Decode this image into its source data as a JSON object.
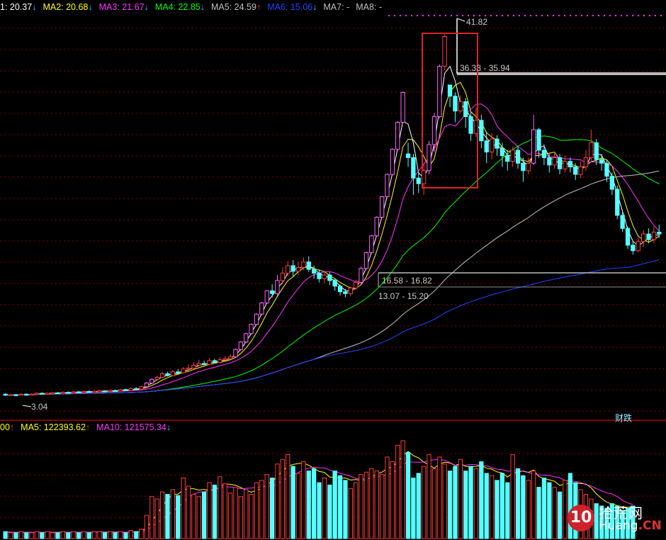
{
  "legend": {
    "items": [
      {
        "label": "1: 20.37",
        "arrow": "↓",
        "color": "#ffffff",
        "arrow_color": "#33ccff"
      },
      {
        "label": "MA2: 20.68",
        "arrow": "↓",
        "color": "#ffff00",
        "arrow_color": "#33ccff"
      },
      {
        "label": "MA3: 21.67",
        "arrow": "↓",
        "color": "#ff33ff",
        "arrow_color": "#33ccff"
      },
      {
        "label": "MA4: 22.85",
        "arrow": "↓",
        "color": "#00ff00",
        "arrow_color": "#33ccff"
      },
      {
        "label": "MA5: 24.59",
        "arrow": "↑",
        "color": "#c0c0c0",
        "arrow_color": "#ff3030"
      },
      {
        "label": "MA6: 15.06",
        "arrow": "↓",
        "color": "#2244ff",
        "arrow_color": "#33ccff"
      },
      {
        "label": "MA7: -",
        "arrow": "",
        "color": "#c0c0c0",
        "arrow_color": "#33ccff"
      },
      {
        "label": "MA8: -",
        "arrow": "",
        "color": "#c0c0c0",
        "arrow_color": "#33ccff"
      }
    ]
  },
  "volume_legend": {
    "items": [
      {
        "label": "00",
        "arrow": "↑",
        "color": "#ffff00",
        "arrow_color": "#ff3030"
      },
      {
        "label": "MA5: 122393.62",
        "arrow": "↑",
        "color": "#ffff00",
        "arrow_color": "#ff3030"
      },
      {
        "label": "MA10: 121575.34",
        "arrow": "↓",
        "color": "#ff33ff",
        "arrow_color": "#33ccff"
      }
    ]
  },
  "annotations": {
    "high": "41.82",
    "low": "3.04",
    "range1": "36.33 - 35.94",
    "range2": "16.58 - 16.82",
    "range3": "13.07 - 15.20",
    "tag": "财",
    "tag2": "跌"
  },
  "logo": {
    "digit": "10",
    "cn": "拾荒网",
    "en_prefix": "Huang",
    "en_suffix": ".CN"
  },
  "colors": {
    "up": "#ff3b3b",
    "down": "#54ffff",
    "limit_up": "#ff66ff",
    "grid": "#8b0000",
    "ma_short": "#ffffff",
    "ma2": "#ffff00",
    "ma3": "#ff33ff",
    "ma4": "#00ff00",
    "ma5": "#c0c0c0",
    "ma6": "#2244ff"
  },
  "chart_data": {
    "type": "candlestick",
    "price_range": [
      2.0,
      44.0
    ],
    "candles": [
      [
        3.2,
        3.1,
        3.3,
        3.0
      ],
      [
        3.1,
        3.15,
        3.25,
        3.05
      ],
      [
        3.15,
        3.1,
        3.2,
        3.04
      ],
      [
        3.1,
        3.2,
        3.3,
        3.05
      ],
      [
        3.2,
        3.15,
        3.3,
        3.1
      ],
      [
        3.15,
        3.2,
        3.3,
        3.1
      ],
      [
        3.2,
        3.3,
        3.4,
        3.15
      ],
      [
        3.3,
        3.25,
        3.4,
        3.2
      ],
      [
        3.25,
        3.3,
        3.4,
        3.2
      ],
      [
        3.3,
        3.35,
        3.45,
        3.25
      ],
      [
        3.35,
        3.3,
        3.45,
        3.25
      ],
      [
        3.3,
        3.4,
        3.5,
        3.25
      ],
      [
        3.4,
        3.35,
        3.5,
        3.3
      ],
      [
        3.35,
        3.45,
        3.55,
        3.3
      ],
      [
        3.45,
        3.4,
        3.55,
        3.35
      ],
      [
        3.4,
        3.5,
        3.6,
        3.35
      ],
      [
        3.5,
        3.45,
        3.6,
        3.4
      ],
      [
        3.45,
        3.5,
        3.6,
        3.4
      ],
      [
        3.5,
        3.55,
        3.65,
        3.45
      ],
      [
        3.55,
        3.5,
        3.65,
        3.45
      ],
      [
        3.5,
        3.6,
        3.7,
        3.45
      ],
      [
        3.6,
        3.55,
        3.7,
        3.5
      ],
      [
        3.55,
        3.7,
        3.8,
        3.5
      ],
      [
        3.7,
        3.6,
        3.8,
        3.55
      ],
      [
        3.6,
        3.8,
        3.9,
        3.55
      ],
      [
        3.8,
        3.75,
        3.95,
        3.7
      ],
      [
        3.75,
        4.0,
        4.1,
        3.7
      ],
      [
        4.0,
        4.4,
        4.5,
        3.95
      ],
      [
        4.4,
        4.8,
        4.9,
        4.3
      ],
      [
        4.8,
        5.0,
        5.2,
        4.7
      ],
      [
        5.0,
        5.4,
        5.6,
        4.9
      ],
      [
        5.4,
        5.2,
        5.6,
        5.1
      ],
      [
        5.2,
        5.6,
        5.8,
        5.1
      ],
      [
        5.6,
        5.5,
        5.9,
        5.4
      ],
      [
        5.5,
        5.9,
        6.1,
        5.4
      ],
      [
        5.9,
        6.0,
        6.4,
        5.8
      ],
      [
        6.0,
        6.3,
        6.6,
        5.9
      ],
      [
        6.3,
        6.5,
        6.9,
        6.2
      ],
      [
        6.5,
        6.4,
        6.8,
        6.3
      ],
      [
        6.4,
        6.8,
        7.1,
        6.3
      ],
      [
        6.8,
        6.6,
        7.0,
        6.5
      ],
      [
        6.6,
        6.9,
        7.2,
        6.5
      ],
      [
        6.9,
        7.0,
        7.3,
        6.8
      ],
      [
        7.0,
        7.2,
        7.5,
        6.9
      ],
      [
        7.2,
        8.0,
        8.1,
        7.1
      ],
      [
        8.0,
        8.8,
        8.9,
        7.9
      ],
      [
        8.8,
        9.7,
        9.8,
        8.7
      ],
      [
        9.7,
        10.7,
        10.8,
        9.6
      ],
      [
        10.7,
        11.8,
        11.9,
        10.6
      ],
      [
        11.8,
        13.0,
        13.1,
        11.7
      ],
      [
        13.0,
        14.3,
        14.4,
        12.9
      ],
      [
        14.3,
        14.0,
        15.0,
        13.6
      ],
      [
        14.0,
        15.4,
        16.0,
        13.8
      ],
      [
        15.4,
        16.2,
        16.8,
        15.0
      ],
      [
        16.2,
        17.0,
        17.5,
        15.9
      ],
      [
        17.0,
        16.4,
        17.6,
        15.8
      ],
      [
        16.4,
        16.8,
        17.4,
        16.0
      ],
      [
        16.8,
        17.4,
        17.9,
        16.5
      ],
      [
        17.4,
        16.6,
        18.0,
        16.3
      ],
      [
        16.6,
        16.2,
        17.0,
        15.6
      ],
      [
        16.2,
        15.6,
        16.6,
        15.2
      ],
      [
        15.6,
        16.0,
        16.4,
        15.1
      ],
      [
        16.0,
        15.4,
        16.3,
        14.9
      ],
      [
        15.4,
        14.8,
        15.6,
        14.3
      ],
      [
        14.8,
        14.2,
        15.0,
        13.8
      ],
      [
        14.2,
        14.0,
        14.5,
        13.6
      ],
      [
        14.0,
        14.6,
        14.8,
        13.7
      ],
      [
        14.6,
        15.2,
        15.5,
        14.4
      ],
      [
        15.2,
        16.7,
        16.9,
        15.0
      ],
      [
        16.7,
        18.4,
        18.5,
        16.6
      ],
      [
        18.4,
        20.2,
        20.3,
        18.3
      ],
      [
        20.2,
        22.2,
        22.3,
        20.1
      ],
      [
        22.2,
        24.4,
        24.5,
        22.1
      ],
      [
        24.4,
        26.8,
        26.9,
        24.3
      ],
      [
        26.8,
        29.5,
        29.6,
        26.7
      ],
      [
        29.5,
        32.4,
        32.5,
        29.4
      ],
      [
        32.4,
        35.6,
        35.7,
        32.3
      ],
      [
        29.0,
        28.6,
        30.2,
        27.6
      ],
      [
        28.6,
        26.4,
        29.0,
        24.6
      ],
      [
        26.4,
        25.8,
        27.0,
        24.8
      ],
      [
        25.8,
        27.2,
        28.0,
        24.6
      ],
      [
        27.2,
        30.0,
        30.4,
        26.8
      ],
      [
        30.0,
        33.0,
        33.4,
        29.2
      ],
      [
        33.0,
        38.4,
        38.6,
        32.8
      ],
      [
        38.4,
        41.6,
        41.82,
        38.0
      ],
      [
        36.4,
        35.2,
        36.33,
        34.0
      ],
      [
        35.2,
        33.6,
        35.6,
        32.4
      ],
      [
        33.6,
        34.6,
        35.3,
        33.4
      ],
      [
        34.6,
        33.0,
        35.0,
        31.8
      ],
      [
        33.0,
        31.2,
        33.6,
        30.4
      ],
      [
        31.2,
        32.6,
        34.0,
        30.8
      ],
      [
        32.6,
        30.4,
        33.2,
        29.6
      ],
      [
        30.4,
        29.2,
        31.4,
        28.0
      ],
      [
        29.2,
        30.6,
        31.2,
        28.4
      ],
      [
        30.6,
        29.6,
        31.0,
        28.8
      ],
      [
        29.6,
        28.8,
        30.2,
        27.6
      ],
      [
        28.8,
        28.2,
        29.4,
        27.2
      ],
      [
        28.2,
        29.4,
        29.8,
        27.6
      ],
      [
        29.4,
        28.0,
        29.8,
        27.4
      ],
      [
        28.0,
        27.2,
        28.6,
        26.0
      ],
      [
        27.2,
        28.0,
        28.6,
        26.8
      ],
      [
        28.0,
        31.6,
        33.2,
        27.8
      ],
      [
        31.6,
        29.4,
        31.8,
        28.6
      ],
      [
        29.4,
        28.6,
        30.0,
        27.8
      ],
      [
        28.6,
        27.8,
        29.0,
        27.0
      ],
      [
        27.8,
        28.6,
        29.2,
        27.4
      ],
      [
        28.6,
        27.4,
        29.0,
        26.8
      ],
      [
        27.4,
        28.2,
        28.8,
        27.0
      ],
      [
        28.2,
        27.6,
        28.6,
        27.0
      ],
      [
        27.6,
        26.8,
        28.0,
        26.2
      ],
      [
        26.8,
        27.6,
        28.2,
        26.4
      ],
      [
        27.6,
        28.6,
        29.4,
        27.2
      ],
      [
        28.6,
        30.2,
        31.6,
        28.2
      ],
      [
        30.2,
        28.4,
        30.6,
        27.8
      ],
      [
        28.4,
        28.0,
        29.0,
        27.2
      ],
      [
        28.0,
        26.6,
        28.4,
        26.0
      ],
      [
        26.6,
        25.2,
        27.0,
        24.6
      ],
      [
        25.2,
        22.4,
        25.6,
        22.0
      ],
      [
        22.4,
        21.0,
        22.8,
        20.6
      ],
      [
        21.0,
        19.2,
        21.2,
        18.8
      ],
      [
        19.2,
        18.6,
        19.6,
        18.2
      ],
      [
        18.6,
        19.6,
        20.0,
        18.4
      ],
      [
        19.6,
        20.4,
        20.8,
        19.0
      ],
      [
        20.4,
        19.8,
        21.0,
        19.4
      ],
      [
        19.8,
        20.6,
        21.2,
        19.4
      ],
      [
        20.6,
        20.4,
        21.4,
        20.0
      ]
    ],
    "volumes": [
      6,
      5,
      5,
      6,
      5,
      5,
      6,
      5,
      6,
      5,
      5,
      6,
      5,
      6,
      5,
      6,
      5,
      6,
      6,
      5,
      6,
      5,
      6,
      5,
      7,
      6,
      8,
      20,
      36,
      34,
      40,
      38,
      42,
      37,
      52,
      45,
      38,
      36,
      40,
      48,
      46,
      53,
      47,
      39,
      44,
      36,
      42,
      38,
      48,
      50,
      55,
      52,
      64,
      68,
      72,
      62,
      56,
      66,
      58,
      60,
      48,
      52,
      46,
      58,
      54,
      50,
      43,
      48,
      55,
      57,
      60,
      58,
      55,
      70,
      66,
      80,
      84,
      74,
      52,
      56,
      62,
      72,
      60,
      70,
      64,
      58,
      62,
      68,
      58,
      62,
      60,
      66,
      56,
      54,
      50,
      56,
      48,
      72,
      60,
      54,
      50,
      58,
      44,
      52,
      48,
      44,
      40,
      50,
      56,
      48,
      42,
      38,
      34,
      30,
      28,
      26,
      30,
      28,
      24,
      26,
      28
    ]
  }
}
